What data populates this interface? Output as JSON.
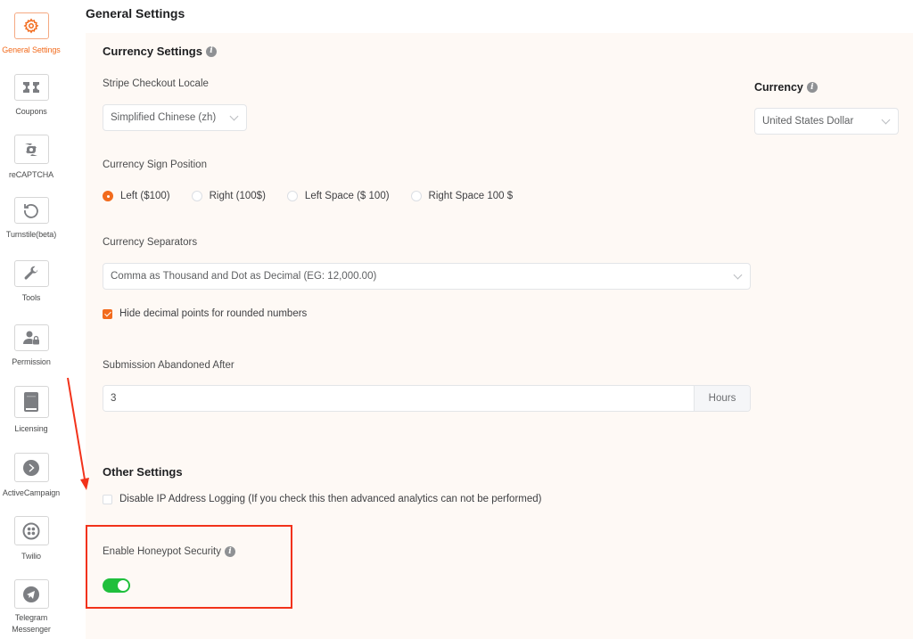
{
  "sidebar": {
    "items": [
      {
        "label": "General Settings",
        "icon": "gear-icon",
        "active": true
      },
      {
        "label": "Coupons",
        "icon": "coupon-icon",
        "active": false
      },
      {
        "label": "reCAPTCHA",
        "icon": "recaptcha-icon",
        "active": false
      },
      {
        "label": "Turnstile(beta)",
        "icon": "turnstile-icon",
        "active": false
      },
      {
        "label": "Tools",
        "icon": "wrench-icon",
        "active": false
      },
      {
        "label": "Permission",
        "icon": "user-lock-icon",
        "active": false
      },
      {
        "label": "Licensing",
        "icon": "book-icon",
        "active": false
      },
      {
        "label": "ActiveCampaign",
        "icon": "activecampaign-icon",
        "active": false
      },
      {
        "label": "Twilio",
        "icon": "twilio-icon",
        "active": false
      },
      {
        "label": "Telegram",
        "label2": "Messenger",
        "icon": "telegram-icon",
        "active": false
      }
    ]
  },
  "header": {
    "title": "General Settings"
  },
  "currency_settings": {
    "title": "Currency Settings",
    "stripe_locale": {
      "label": "Stripe Checkout Locale",
      "value": "Simplified Chinese (zh)"
    },
    "currency": {
      "label": "Currency",
      "value": "United States Dollar"
    },
    "sign_position": {
      "label": "Currency Sign Position",
      "options": [
        {
          "label": "Left ($100)",
          "checked": true
        },
        {
          "label": "Right (100$)",
          "checked": false
        },
        {
          "label": "Left Space ($ 100)",
          "checked": false
        },
        {
          "label": "Right Space 100 $",
          "checked": false
        }
      ]
    },
    "separators": {
      "label": "Currency Separators",
      "value": "Comma as Thousand and Dot as Decimal (EG: 12,000.00)"
    },
    "hide_decimal": {
      "label": "Hide decimal points for rounded numbers",
      "checked": true
    },
    "abandoned": {
      "label": "Submission Abandoned After",
      "value": "3",
      "suffix": "Hours"
    }
  },
  "other_settings": {
    "title": "Other Settings",
    "disable_ip": {
      "label": "Disable IP Address Logging (If you check this then advanced analytics can not be performed)",
      "checked": false
    },
    "honeypot": {
      "label": "Enable Honeypot Security",
      "enabled": true
    }
  },
  "colors": {
    "accent": "#f26b1d",
    "toggle_on": "#1fbf3c",
    "panel_bg": "#fef9f5",
    "annotation": "#f2321a"
  }
}
